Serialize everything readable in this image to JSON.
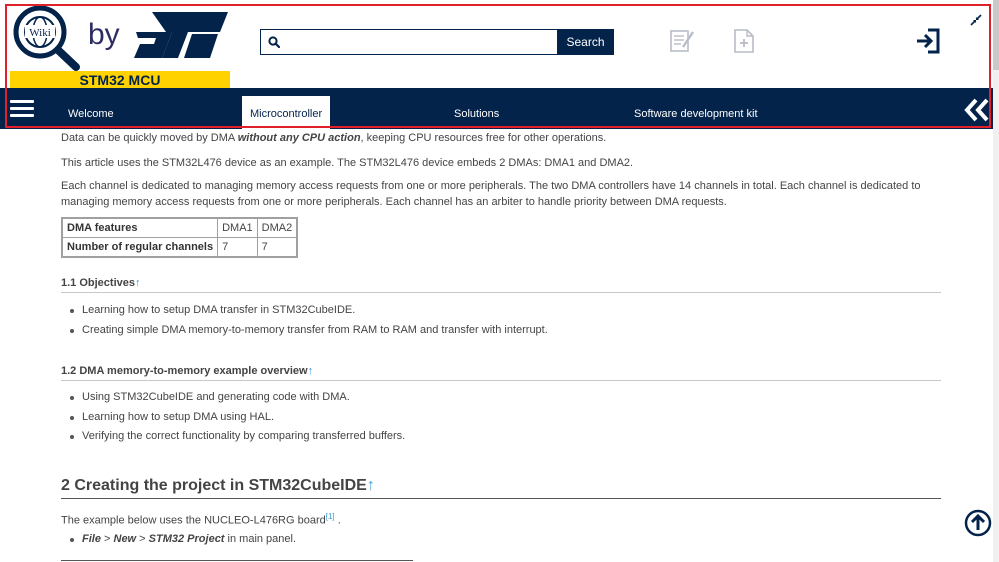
{
  "header": {
    "logo_by": "by",
    "logo_band": "STM32 MCU",
    "search": {
      "placeholder": "",
      "value": "",
      "button_label": "Search"
    }
  },
  "nav": {
    "items": [
      {
        "label": "Welcome",
        "active": false
      },
      {
        "label": "Microcontroller",
        "active": true
      },
      {
        "label": "Solutions",
        "active": false
      },
      {
        "label": "Software development kit",
        "active": false
      }
    ]
  },
  "content": {
    "line1_pre": "Data can be quickly moved by DMA ",
    "line1_em": "without any CPU action",
    "line1_post": ", keeping CPU resources free for other operations.",
    "line2": "This article uses the STM32L476 device as an example. The STM32L476 device embeds 2 DMAs: DMA1 and DMA2.",
    "line3": "Each channel is dedicated to managing memory access requests from one or more peripherals. The two DMA controllers have 14 channels in total. Each channel is dedicated to managing memory access requests from one or more peripherals. Each channel has an arbiter to handle priority between DMA requests.",
    "table": {
      "rows": [
        [
          "DMA features",
          "DMA1",
          "DMA2"
        ],
        [
          "Number of regular channels",
          "7",
          "7"
        ]
      ]
    },
    "sec_objectives": {
      "title": "1.1 Objectives",
      "arrow": "↑",
      "items": [
        "Learning how to setup DMA transfer in STM32CubeIDE.",
        "Creating simple DMA memory-to-memory transfer from RAM to RAM and transfer with interrupt."
      ]
    },
    "sec_overview": {
      "title": "1.2 DMA memory-to-memory example overview",
      "arrow": "↑",
      "items": [
        "Using STM32CubeIDE and generating code with DMA.",
        "Learning how to setup DMA using HAL.",
        "Verifying the correct functionality by comparing transferred buffers."
      ]
    },
    "sec_create": {
      "title": "2 Creating the project in STM32CubeIDE",
      "arrow": "↑",
      "intro": "The example below uses the NUCLEO-L476RG board",
      "ref": "[1]",
      "intro_end": " .",
      "menu": {
        "file": "File",
        "sep1": " > ",
        "new": "New",
        "sep2": " > ",
        "project": "STM32 Project",
        "suffix": " in main panel."
      }
    }
  },
  "colors": {
    "navy": "#03234b",
    "yellow": "#ffd200",
    "highlight": "#e0202a",
    "link": "#3a9ad9"
  },
  "icons": [
    "wiki-magnifier-icon",
    "st-logo-icon",
    "search-icon",
    "edit-page-icon",
    "add-page-icon",
    "collapse-icon",
    "login-icon",
    "hamburger-icon",
    "chevron-left-double-icon",
    "scroll-top-icon"
  ]
}
